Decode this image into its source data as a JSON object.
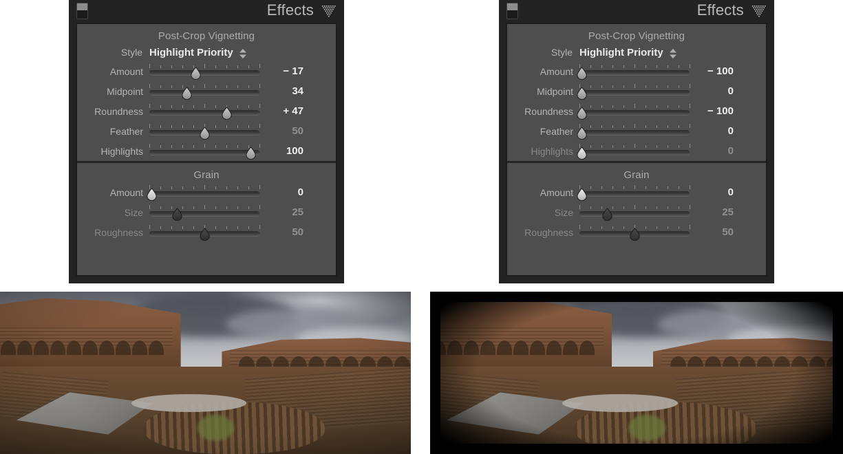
{
  "panels": [
    {
      "id": "left",
      "header": {
        "title": "Effects",
        "toggle_icon": "panel-toggle-icon",
        "mesh_icon": "dotted-triangle-icon"
      },
      "sections": [
        {
          "title": "Post-Crop Vignetting",
          "style": {
            "label": "Style",
            "value": "Highlight Priority",
            "stepper_icon": "up-down-chevron-icon"
          },
          "sliders": [
            {
              "label": "Amount",
              "value": "− 17",
              "pos": 42,
              "dim_label": false,
              "dim_value": false,
              "handle": "light"
            },
            {
              "label": "Midpoint",
              "value": "34",
              "pos": 34,
              "dim_label": false,
              "dim_value": false,
              "handle": "light"
            },
            {
              "label": "Roundness",
              "value": "+ 47",
              "pos": 70,
              "dim_label": false,
              "dim_value": false,
              "handle": "light"
            },
            {
              "label": "Feather",
              "value": "50",
              "pos": 50,
              "dim_label": false,
              "dim_value": true,
              "handle": "light"
            },
            {
              "label": "Highlights",
              "value": "100",
              "pos": 92,
              "dim_label": false,
              "dim_value": false,
              "handle": "light"
            }
          ]
        },
        {
          "title": "Grain",
          "sliders": [
            {
              "label": "Amount",
              "value": "0",
              "pos": 2,
              "dim_label": false,
              "dim_value": false,
              "handle": "bright"
            },
            {
              "label": "Size",
              "value": "25",
              "pos": 25,
              "dim_label": true,
              "dim_value": true,
              "handle": "dark"
            },
            {
              "label": "Roughness",
              "value": "50",
              "pos": 50,
              "dim_label": true,
              "dim_value": true,
              "handle": "dark"
            }
          ]
        }
      ]
    },
    {
      "id": "right",
      "header": {
        "title": "Effects",
        "toggle_icon": "panel-toggle-icon",
        "mesh_icon": "dotted-triangle-icon"
      },
      "sections": [
        {
          "title": "Post-Crop Vignetting",
          "style": {
            "label": "Style",
            "value": "Highlight Priority",
            "stepper_icon": "up-down-chevron-icon"
          },
          "sliders": [
            {
              "label": "Amount",
              "value": "− 100",
              "pos": 2,
              "dim_label": false,
              "dim_value": false,
              "handle": "light"
            },
            {
              "label": "Midpoint",
              "value": "0",
              "pos": 2,
              "dim_label": false,
              "dim_value": false,
              "handle": "light"
            },
            {
              "label": "Roundness",
              "value": "− 100",
              "pos": 2,
              "dim_label": false,
              "dim_value": false,
              "handle": "light"
            },
            {
              "label": "Feather",
              "value": "0",
              "pos": 2,
              "dim_label": false,
              "dim_value": false,
              "handle": "light"
            },
            {
              "label": "Highlights",
              "value": "0",
              "pos": 2,
              "dim_label": true,
              "dim_value": true,
              "handle": "bright"
            }
          ]
        },
        {
          "title": "Grain",
          "sliders": [
            {
              "label": "Amount",
              "value": "0",
              "pos": 2,
              "dim_label": false,
              "dim_value": false,
              "handle": "bright"
            },
            {
              "label": "Size",
              "value": "25",
              "pos": 25,
              "dim_label": true,
              "dim_value": true,
              "handle": "dark"
            },
            {
              "label": "Roughness",
              "value": "50",
              "pos": 50,
              "dim_label": true,
              "dim_value": true,
              "handle": "dark"
            }
          ]
        }
      ]
    }
  ],
  "photos": [
    {
      "id": "left-photo",
      "caption": "",
      "vignette": "soft",
      "alt": "Interior of the Roman Colosseum under stormy clouds"
    },
    {
      "id": "right-photo",
      "caption": "",
      "vignette": "heavy",
      "alt": "Interior of the Roman Colosseum under stormy clouds with heavy rounded vignette"
    }
  ],
  "colors": {
    "panel_frame": "#232323",
    "panel_body": "#4e4e4e",
    "label": "#b5b5b5",
    "label_dim": "#8a8a8a",
    "value": "#f0f0f0",
    "value_dim": "#919191",
    "title": "#b9b9b9"
  }
}
